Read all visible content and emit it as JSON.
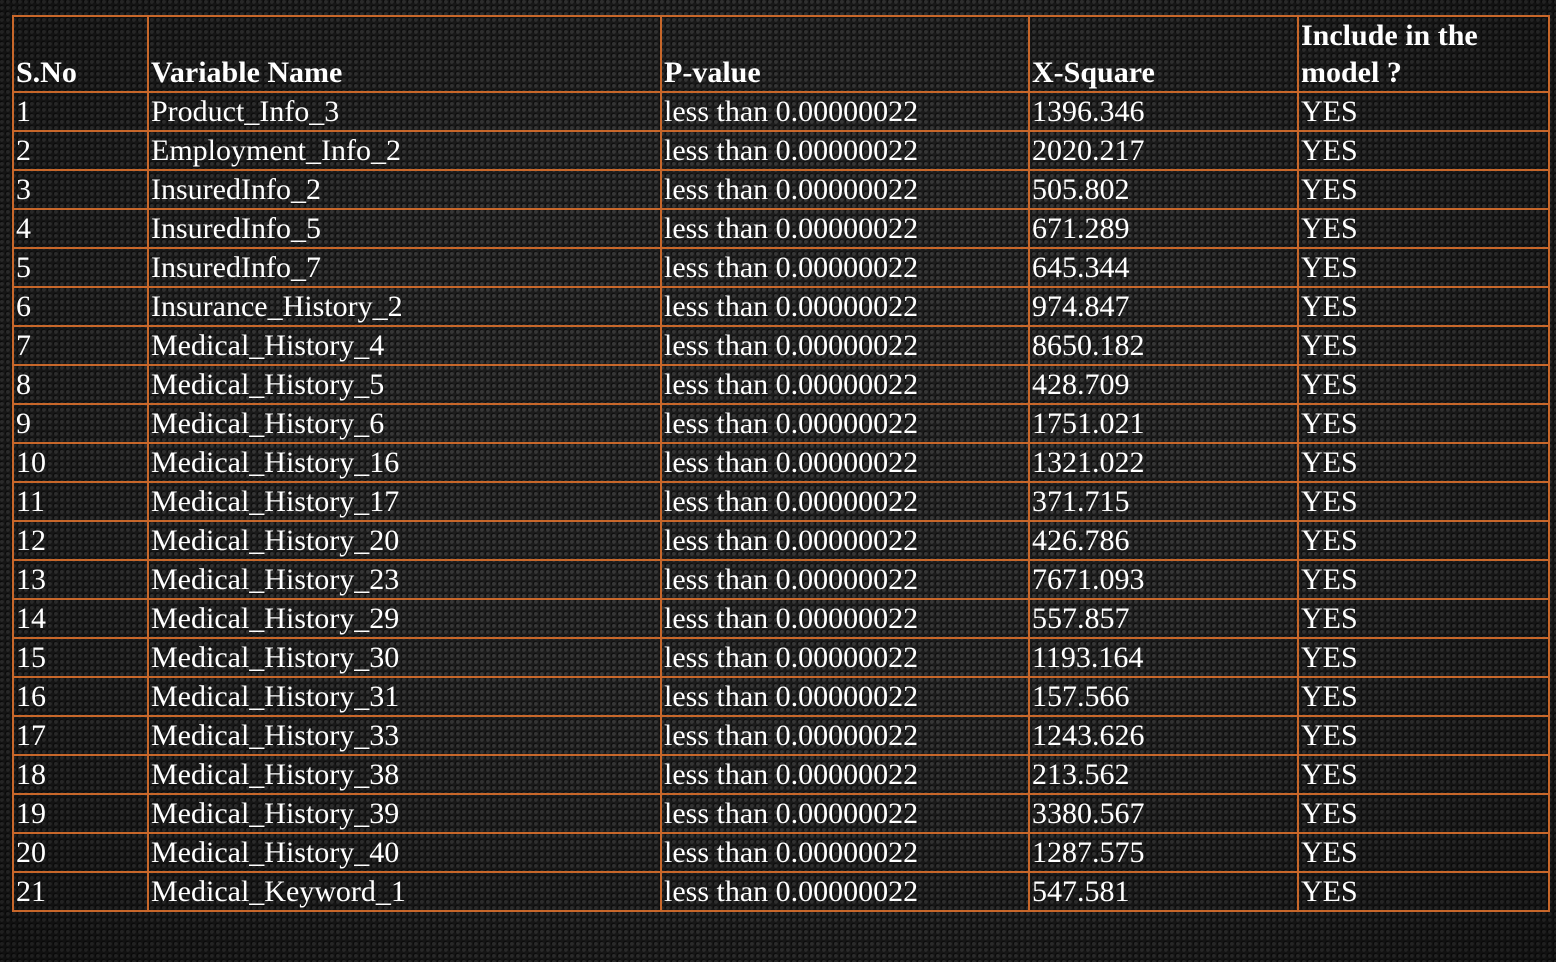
{
  "table": {
    "headers": {
      "sno": "S.No",
      "variable_name": "Variable Name",
      "p_value": "P-value",
      "x_square": "X-Square",
      "include": "Include in the model ?"
    },
    "rows": [
      {
        "sno": "1",
        "name": "Product_Info_3",
        "p": "less than 0.00000022",
        "x": "1396.346",
        "inc": "YES"
      },
      {
        "sno": "2",
        "name": "Employment_Info_2",
        "p": "less than 0.00000022",
        "x": "2020.217",
        "inc": "YES"
      },
      {
        "sno": "3",
        "name": "InsuredInfo_2",
        "p": "less than 0.00000022",
        "x": "505.802",
        "inc": "YES"
      },
      {
        "sno": "4",
        "name": "InsuredInfo_5",
        "p": "less than 0.00000022",
        "x": "671.289",
        "inc": "YES"
      },
      {
        "sno": "5",
        "name": "InsuredInfo_7",
        "p": "less than 0.00000022",
        "x": "645.344",
        "inc": "YES"
      },
      {
        "sno": "6",
        "name": "Insurance_History_2",
        "p": "less than 0.00000022",
        "x": "974.847",
        "inc": "YES"
      },
      {
        "sno": "7",
        "name": "Medical_History_4",
        "p": "less than 0.00000022",
        "x": "8650.182",
        "inc": "YES"
      },
      {
        "sno": "8",
        "name": "Medical_History_5",
        "p": "less than 0.00000022",
        "x": "428.709",
        "inc": "YES"
      },
      {
        "sno": "9",
        "name": "Medical_History_6",
        "p": "less than 0.00000022",
        "x": "1751.021",
        "inc": "YES"
      },
      {
        "sno": "10",
        "name": "Medical_History_16",
        "p": "less than 0.00000022",
        "x": "1321.022",
        "inc": "YES"
      },
      {
        "sno": "11",
        "name": "Medical_History_17",
        "p": "less than 0.00000022",
        "x": "371.715",
        "inc": "YES"
      },
      {
        "sno": "12",
        "name": "Medical_History_20",
        "p": "less than 0.00000022",
        "x": "426.786",
        "inc": "YES"
      },
      {
        "sno": "13",
        "name": "Medical_History_23",
        "p": "less than 0.00000022",
        "x": "7671.093",
        "inc": "YES"
      },
      {
        "sno": "14",
        "name": "Medical_History_29",
        "p": "less than 0.00000022",
        "x": "557.857",
        "inc": "YES"
      },
      {
        "sno": "15",
        "name": "Medical_History_30",
        "p": "less than 0.00000022",
        "x": "1193.164",
        "inc": "YES"
      },
      {
        "sno": "16",
        "name": "Medical_History_31",
        "p": "less than 0.00000022",
        "x": "157.566",
        "inc": "YES"
      },
      {
        "sno": "17",
        "name": "Medical_History_33",
        "p": "less than 0.00000022",
        "x": "1243.626",
        "inc": "YES"
      },
      {
        "sno": "18",
        "name": "Medical_History_38",
        "p": "less than 0.00000022",
        "x": "213.562",
        "inc": "YES"
      },
      {
        "sno": "19",
        "name": "Medical_History_39",
        "p": "less than 0.00000022",
        "x": "3380.567",
        "inc": "YES"
      },
      {
        "sno": "20",
        "name": "Medical_History_40",
        "p": "less than 0.00000022",
        "x": "1287.575",
        "inc": "YES"
      },
      {
        "sno": "21",
        "name": "Medical_Keyword_1",
        "p": "less than 0.00000022",
        "x": "547.581",
        "inc": "YES"
      }
    ]
  },
  "colors": {
    "border": "#c8672a",
    "background": "#1c1c1c",
    "text": "#ffffff"
  }
}
